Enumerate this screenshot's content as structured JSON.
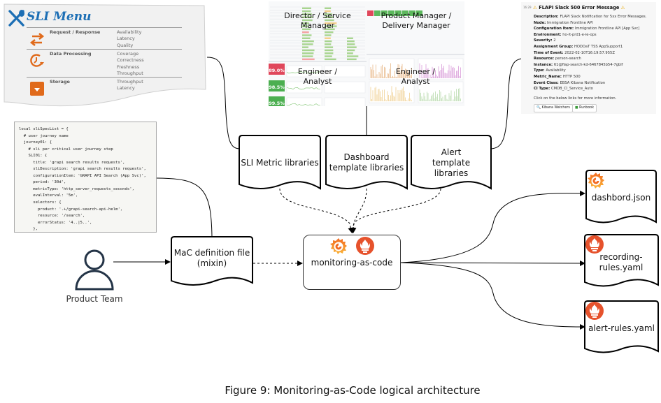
{
  "sli_menu": {
    "title": "SLI Menu",
    "accent_color": "#1d6fb5",
    "icon_color": "#e06a1b",
    "rows": [
      {
        "category": "Request / Response",
        "icon": "swap-arrows-icon",
        "items": [
          "Availability",
          "Latency",
          "Quality"
        ]
      },
      {
        "category": "Data Processing",
        "icon": "clock-refresh-icon",
        "items": [
          "Coverage",
          "Correctness",
          "Freshness",
          "Throughput"
        ]
      },
      {
        "category": "Storage",
        "icon": "storage-box-icon",
        "items": [
          "Throughput",
          "Latency"
        ]
      }
    ]
  },
  "code_snippet": {
    "lines": [
      "local sliSpecList = {",
      "  # user journey name",
      "  journey01: {",
      "    # sli per critical user journey step",
      "    SLI01: {",
      "      title: 'grapi search results requests',",
      "      sliDescription: 'grapi search results requests',",
      "      configurationItem: 'GRAPI API Search (App Svc)',",
      "      period: '30d',",
      "      metricType: 'http_server_requests_seconds',",
      "      evalInterval: '5m',",
      "      selectors: {",
      "        product: '.+/grapi-search-api-helm',",
      "        resource: '/search',",
      "        errorStatus: '4..|5..',",
      "      },"
    ]
  },
  "dashboards": {
    "left_top_label": "Director / Service Manager",
    "left_bottom_label": "Engineer / Analyst",
    "right_top_label": "Product Manager / Delivery Manager",
    "right_bottom_label": "Engineer / Analyst",
    "stat_values": [
      "89.0%",
      "98.5%",
      "99.5%"
    ],
    "stat_colors": [
      "#e0475b",
      "#4caf50",
      "#4caf50"
    ]
  },
  "alert_message": {
    "timestamp": "16:29",
    "title": "FLAPI Slack 500 Error Message",
    "warning_icon": "warning-icon",
    "fields": [
      {
        "label": "Description:",
        "value": "FLAPI Slack Notification for 5xx Error Messages."
      },
      {
        "label": "Node:",
        "value": "Immigration Frontline API"
      },
      {
        "label": "Configuration Item:",
        "value": "Immigration Frontline API [App Svc]"
      },
      {
        "label": "Environment:",
        "value": "ho-it-prd1-e-ie-ops"
      },
      {
        "label": "Severity:",
        "value": "2"
      },
      {
        "label": "Assignment Group:",
        "value": "HODDaT TSS AppSupport1"
      },
      {
        "label": "Time of Event:",
        "value": "2022-02-10T16:19:57.955Z"
      },
      {
        "label": "Resource:",
        "value": "person-search"
      },
      {
        "label": "Instance:",
        "value": "61@flap-search-kd-6467845b54-7gblf"
      },
      {
        "label": "Type:",
        "value": "Availability"
      },
      {
        "label": "Metric_Name:",
        "value": "HTTP 500"
      },
      {
        "label": "Event Class:",
        "value": "EBSA Kibana Notification"
      },
      {
        "label": "CI Type:",
        "value": "CMDB_CI_Service_Auto"
      }
    ],
    "footer": "Click on the below links for more information.",
    "buttons": [
      "Kibana Watchers",
      "Runbook"
    ]
  },
  "libraries": {
    "sli_metric": "SLI Metric libraries",
    "dashboard_template": "Dashboard template libraries",
    "alert_template": "Alert template libraries"
  },
  "actors": {
    "product_team": "Product Team"
  },
  "nodes": {
    "mac_definition": "MaC definition file (mixin)",
    "monitoring_as_code": "monitoring-as-code"
  },
  "outputs": {
    "dashboard_json": "dashbord.json",
    "recording_rules": "recording-rules.yaml",
    "alert_rules": "alert-rules.yaml"
  },
  "brand_colors": {
    "grafana_orange": "#f26a21",
    "grafana_yellow": "#fbb63a",
    "prometheus_red": "#e6522c"
  },
  "caption": "Figure 9:  Monitoring-as-Code logical architecture"
}
